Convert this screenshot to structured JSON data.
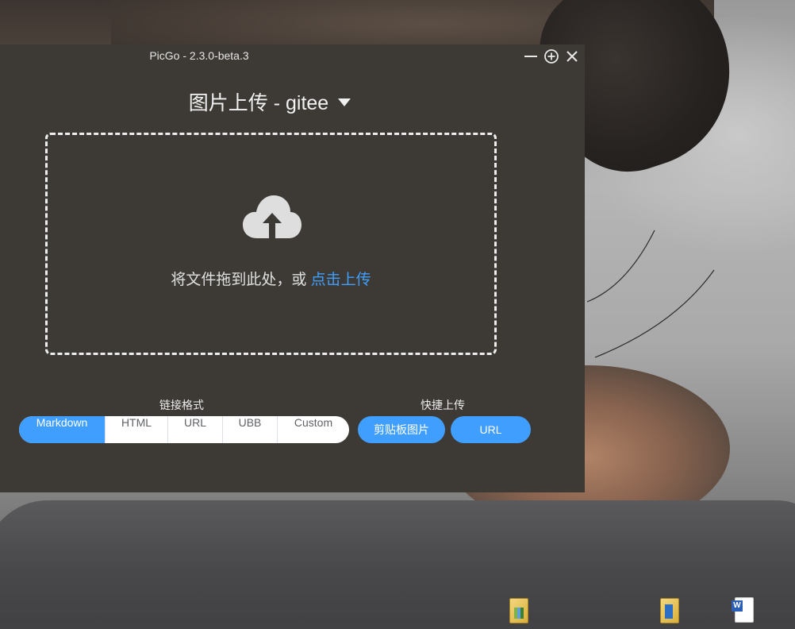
{
  "window": {
    "title": "PicGo - 2.3.0-beta.3"
  },
  "uploader": {
    "title": "图片上传 - gitee"
  },
  "dropzone": {
    "text": "将文件拖到此处，或 ",
    "link": "点击上传"
  },
  "link_format": {
    "label": "链接格式",
    "options": [
      "Markdown",
      "HTML",
      "URL",
      "UBB",
      "Custom"
    ],
    "selected": "Markdown"
  },
  "quick_upload": {
    "label": "快捷上传",
    "clipboard_button": "剪贴板图片",
    "url_button": "URL"
  },
  "colors": {
    "accent": "#409eff",
    "window_bg": "#3d3a36"
  },
  "desktop_icons": [
    "folder-icon",
    "folder-icon",
    "word-document-icon"
  ]
}
